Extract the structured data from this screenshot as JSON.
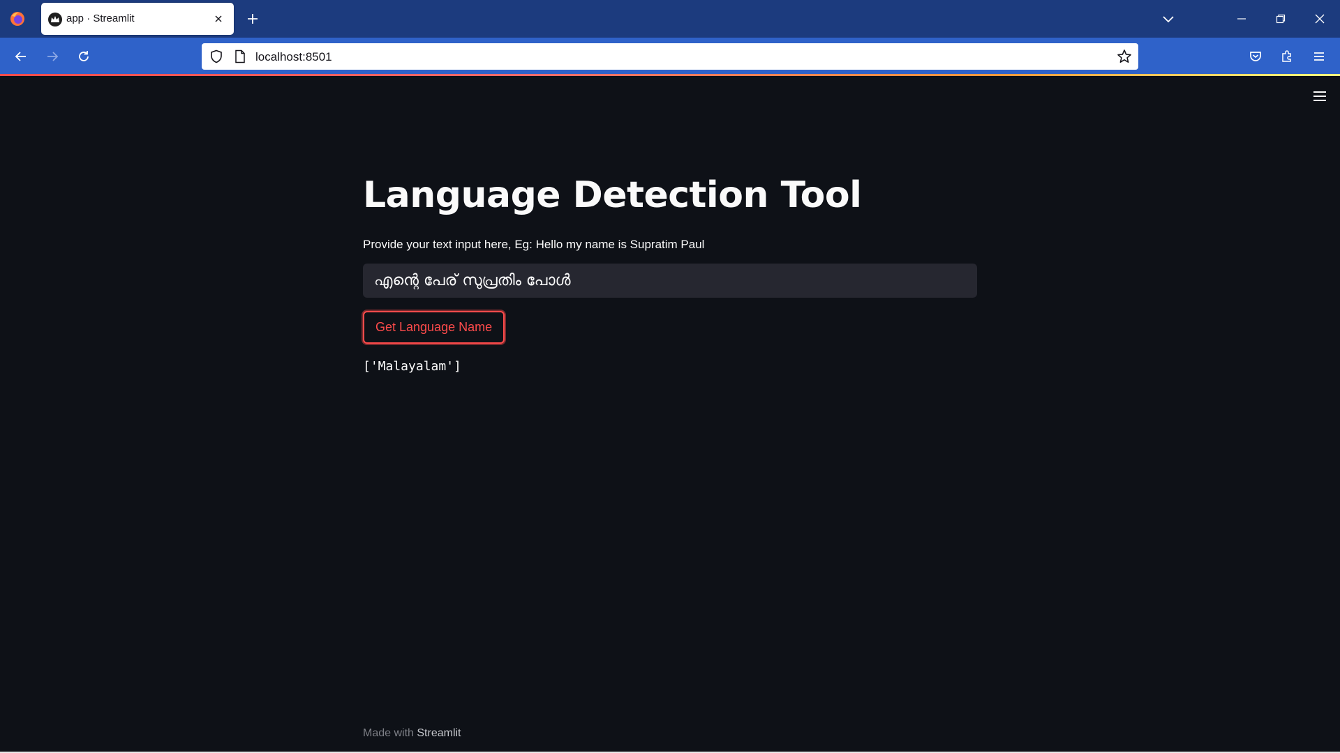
{
  "browser": {
    "tab": {
      "title": "app · Streamlit"
    },
    "url": "localhost:8501",
    "icons": {
      "firefox": "firefox-logo-icon",
      "favicon": "streamlit-crown-icon",
      "close_tab": "close-icon",
      "new_tab": "plus-icon",
      "tab_list": "chevron-down-icon",
      "back": "arrow-left-icon",
      "forward": "arrow-right-icon",
      "reload": "reload-icon",
      "tracking_protection": "shield-icon",
      "page_info": "page-icon",
      "bookmark": "star-icon",
      "pocket": "pocket-icon",
      "extensions": "puzzle-icon",
      "menu": "hamburger-menu-icon",
      "minimize": "minimize-icon",
      "restore": "restore-icon",
      "close_window": "close-icon"
    },
    "colors": {
      "tabbar": "#1c3b7e",
      "navbar": "#2f62c9"
    }
  },
  "app": {
    "title": "Language Detection Tool",
    "input": {
      "label": "Provide your text input here, Eg: Hello my name is Supratim Paul",
      "value": "എന്റെ പേര് സുപ്രതിം പോൾ"
    },
    "button": {
      "label": "Get Language Name"
    },
    "result": "['Malayalam']",
    "menu_icon": "hamburger-menu-icon",
    "footer": {
      "prefix": "Made with ",
      "link": "Streamlit"
    },
    "colors": {
      "background": "#0e1117",
      "accent": "#ff4b4b",
      "input_bg": "#262730",
      "text": "#fafafa"
    }
  }
}
